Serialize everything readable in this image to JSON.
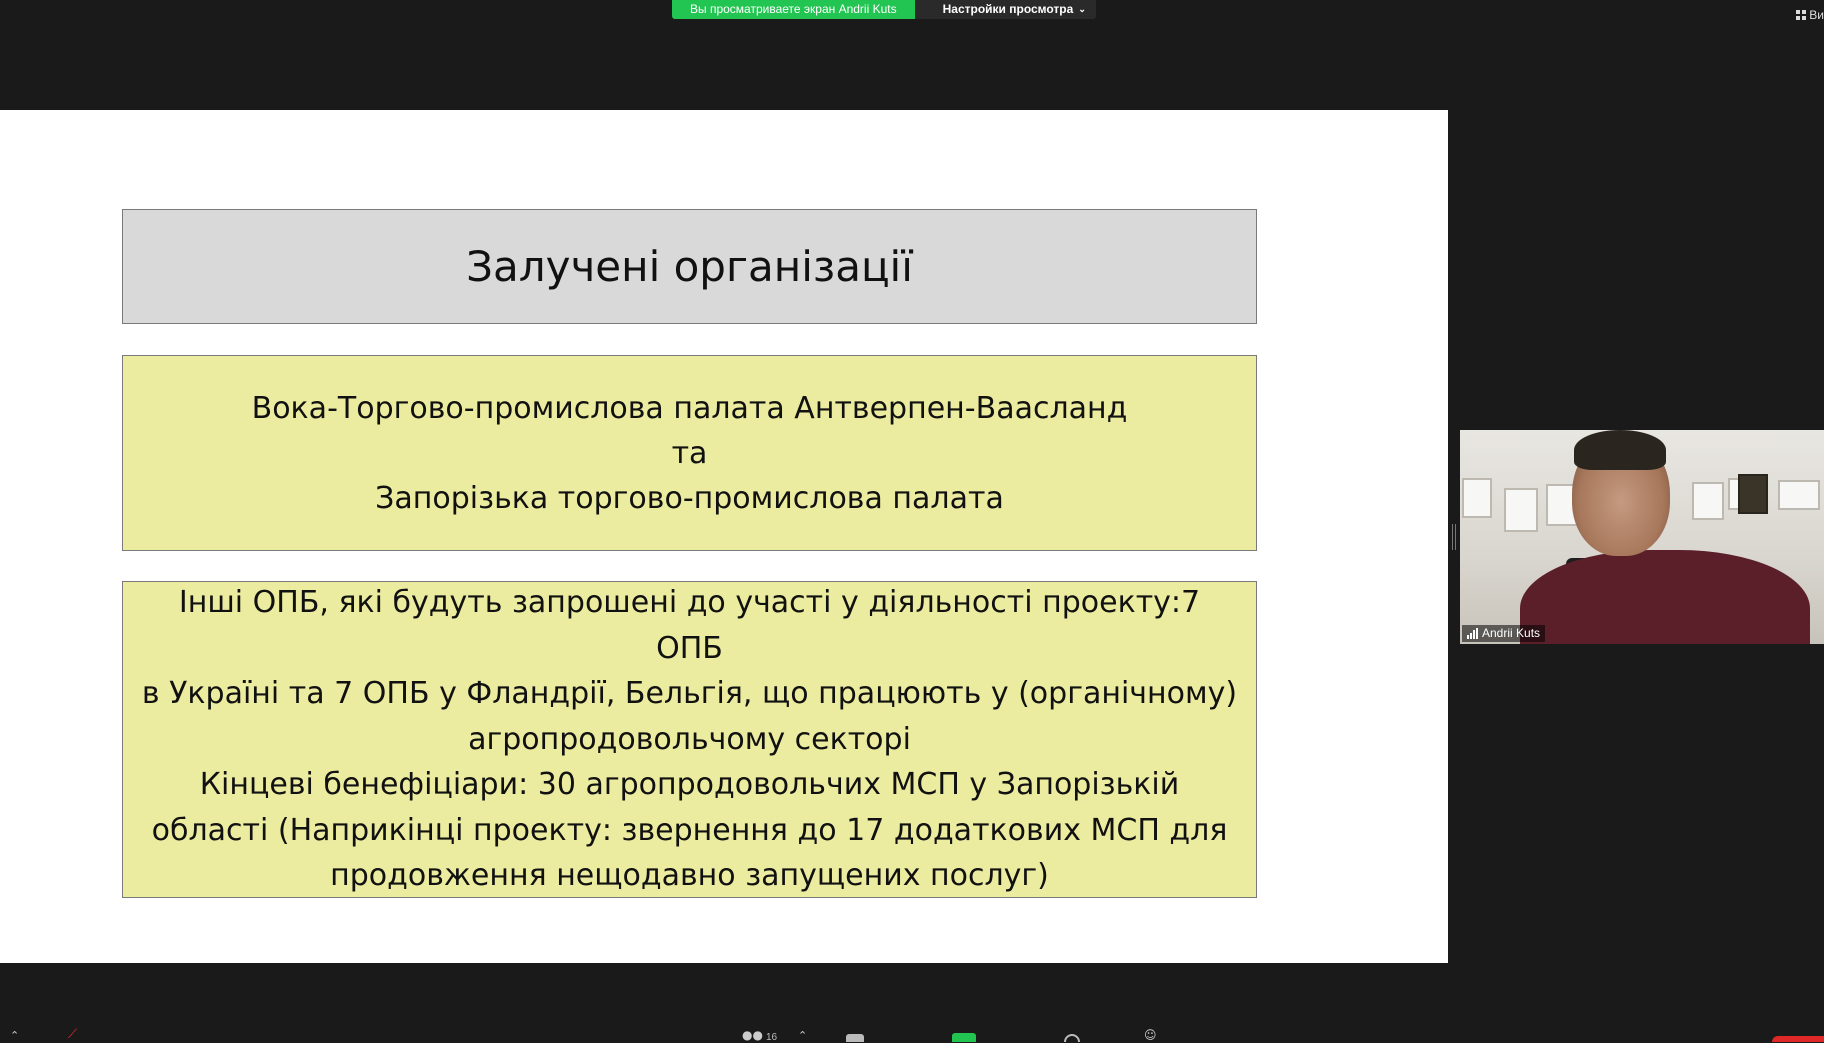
{
  "topbar": {
    "share_banner": "Вы просматриваете экран Andrii Kuts",
    "view_options": "Настройки просмотра",
    "corner_label": "Ви"
  },
  "slide": {
    "title": "Залучені організації",
    "orgs": [
      "Вока-Торгово-промислова палата Антверпен-Ваасланд",
      "та",
      "Запорізька торгово-промислова палата"
    ],
    "others": [
      "Інші ОПБ, які будуть запрошені до участі у діяльності проекту:7 ОПБ",
      "в Україні та 7 ОПБ у Фландрії, Бельгія, що працюють у (органічному)",
      "агропродовольчому секторі",
      "Кінцеві бенефіціари: 30 агропродовольчих МСП у Запорізькій",
      "області (Наприкінці проекту: звернення до 17 додаткових МСП для",
      "продовження нещодавно запущених послуг)"
    ]
  },
  "participant": {
    "name": "Andrii Kuts"
  },
  "toolbar": {
    "participants_count": "16"
  },
  "colors": {
    "share_green": "#23c552",
    "title_box": "#d9d9d9",
    "content_box": "#ececa0",
    "end_red": "#e02828"
  }
}
